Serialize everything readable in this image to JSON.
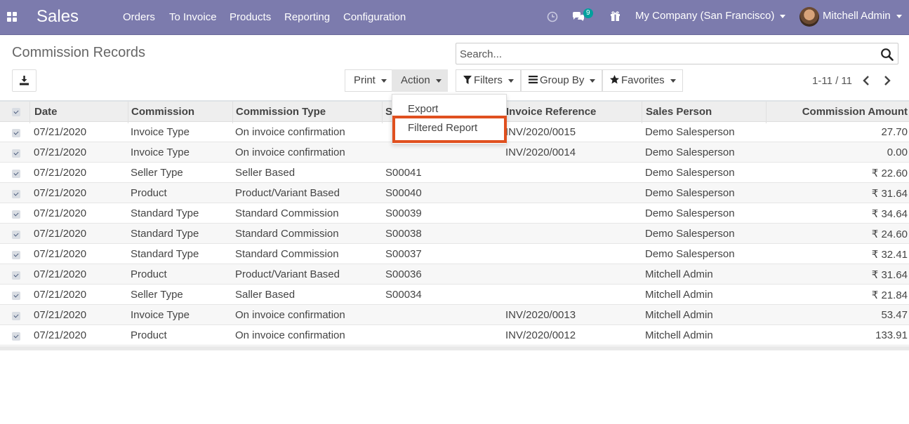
{
  "navbar": {
    "app_name": "Sales",
    "menu": [
      "Orders",
      "To Invoice",
      "Products",
      "Reporting",
      "Configuration"
    ],
    "messages_count": "9",
    "company": "My Company (San Francisco)",
    "user": "Mitchell Admin",
    "color": "#7c7bad"
  },
  "control_panel": {
    "title": "Commission Records",
    "search_placeholder": "Search...",
    "print_label": "Print",
    "action_label": "Action",
    "filters_label": "Filters",
    "group_by_label": "Group By",
    "favorites_label": "Favorites",
    "pager": "1-11 / 11"
  },
  "action_menu": {
    "items": [
      "Export",
      "Filtered Report"
    ],
    "highlight_color": "#e0501f"
  },
  "table": {
    "columns": [
      "Date",
      "Commission",
      "Commission Type",
      "S",
      "Invoice Reference",
      "Sales Person",
      "Commission Amount"
    ],
    "rows": [
      [
        "07/21/2020",
        "Invoice Type",
        "On invoice confirmation",
        "",
        "INV/2020/0015",
        "Demo Salesperson",
        "27.70"
      ],
      [
        "07/21/2020",
        "Invoice Type",
        "On invoice confirmation",
        "",
        "INV/2020/0014",
        "Demo Salesperson",
        "0.00"
      ],
      [
        "07/21/2020",
        "Seller Type",
        "Seller Based",
        "S00041",
        "",
        "Demo Salesperson",
        "₹ 22.60"
      ],
      [
        "07/21/2020",
        "Product",
        "Product/Variant Based",
        "S00040",
        "",
        "Demo Salesperson",
        "₹ 31.64"
      ],
      [
        "07/21/2020",
        "Standard Type",
        "Standard Commission",
        "S00039",
        "",
        "Demo Salesperson",
        "₹ 34.64"
      ],
      [
        "07/21/2020",
        "Standard Type",
        "Standard Commission",
        "S00038",
        "",
        "Demo Salesperson",
        "₹ 24.60"
      ],
      [
        "07/21/2020",
        "Standard Type",
        "Standard Commission",
        "S00037",
        "",
        "Demo Salesperson",
        "₹ 32.41"
      ],
      [
        "07/21/2020",
        "Product",
        "Product/Variant Based",
        "S00036",
        "",
        "Mitchell Admin",
        "₹ 31.64"
      ],
      [
        "07/21/2020",
        "Seller Type",
        "Saller Based",
        "S00034",
        "",
        "Mitchell Admin",
        "₹ 21.84"
      ],
      [
        "07/21/2020",
        "Invoice Type",
        "On invoice confirmation",
        "",
        "INV/2020/0013",
        "Mitchell Admin",
        "53.47"
      ],
      [
        "07/21/2020",
        "Product",
        "On invoice confirmation",
        "",
        "INV/2020/0012",
        "Mitchell Admin",
        "133.91"
      ]
    ]
  }
}
